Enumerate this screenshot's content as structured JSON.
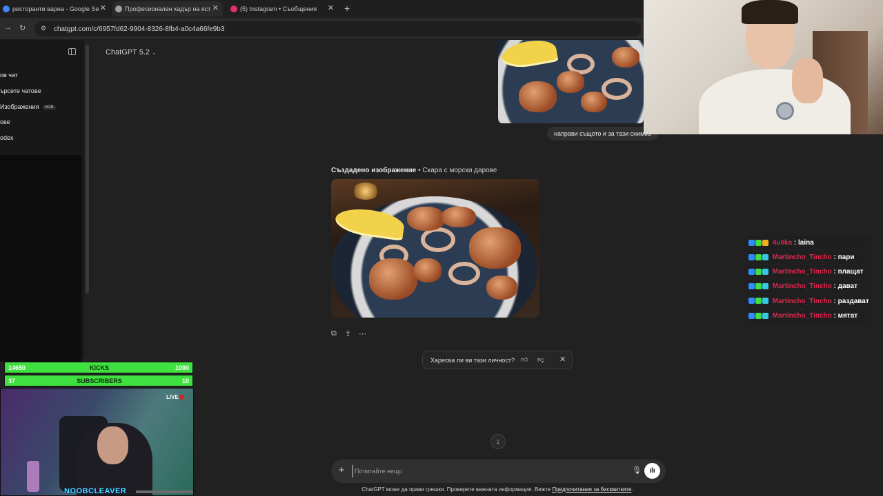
{
  "tabs": [
    {
      "title": "ресторанти варна - Google Se",
      "favicon_color": "#4285f4"
    },
    {
      "title": "Професионален кадър на яст",
      "favicon_color": "#a0a0a0"
    },
    {
      "title": "(5) Instagram • Съобщения",
      "favicon_color": "#e1306c"
    }
  ],
  "address_bar": {
    "url": "chatgpt.com/c/6957fd62-9904-8326-8fb4-a0c4a66fe9b3"
  },
  "sidebar": {
    "items": [
      {
        "label": "ов чат"
      },
      {
        "label": "ърсете чатове"
      },
      {
        "label": "Изображения",
        "badge": "НОВ"
      },
      {
        "label": "ове"
      },
      {
        "label": "odex"
      }
    ]
  },
  "header": {
    "model": "ChatGPT 5.2"
  },
  "conversation": {
    "user_message": "направи същото и за тази снимка",
    "generated_label": "Създадено изображение",
    "generated_title": "Скара с морски дарове",
    "feedback_question": "Харесва ли ви тази личност?"
  },
  "composer": {
    "placeholder": "Попитайте нещо"
  },
  "disclaimer": {
    "text": "ChatGPT може да прави грешки. Проверете важната информация. Вижте ",
    "link": "Предпочитания за бисквитките",
    "end": "."
  },
  "chat_overlay": [
    {
      "user": "4u6ka",
      "message": "laina"
    },
    {
      "user": "Martincho_Tincho",
      "message": "пари"
    },
    {
      "user": "Martincho_Tincho",
      "message": "плащат"
    },
    {
      "user": "Martincho_Tincho",
      "message": "дават"
    },
    {
      "user": "Martincho_Tincho",
      "message": "раздават"
    },
    {
      "user": "Martincho_Tincho",
      "message": "мятат"
    }
  ],
  "stream_overlay": {
    "kicks": {
      "current": "14650",
      "label": "KICKS",
      "goal": "1000"
    },
    "subscribers": {
      "current": "37",
      "label": "SUBSCRIBERS",
      "goal": "10"
    },
    "live_label": "LIVE",
    "streamer_name": "NOOBCLEAVER"
  },
  "colors": {
    "accent_green": "#3fe03f",
    "chat_user": "#e0264c",
    "page_bg": "#212121"
  }
}
